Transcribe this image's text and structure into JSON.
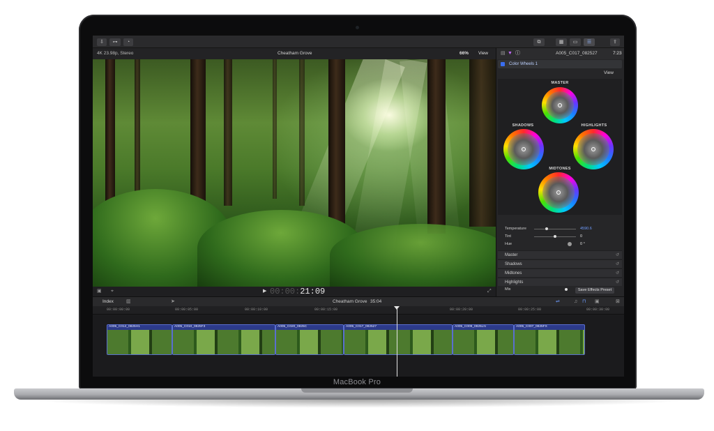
{
  "device": {
    "brand": "MacBook Pro"
  },
  "viewer": {
    "format": "4K 23.98p, Stereo",
    "title": "Cheatham Grove",
    "zoom": "66%",
    "view_label": "View",
    "timecode_dim": "00:00:",
    "timecode": "21:09"
  },
  "inspector": {
    "clip_name": "A005_C017_082527",
    "time": "7:23",
    "effect_name": "Color Wheels 1",
    "view_label": "View",
    "wheels": {
      "master": "MASTER",
      "shadows": "SHADOWS",
      "highlights": "HIGHLIGHTS",
      "midtones": "MIDTONES"
    },
    "params": [
      {
        "label": "Temperature",
        "value": "4590.6"
      },
      {
        "label": "Tint",
        "value": "0"
      },
      {
        "label": "Hue",
        "value": "0 °"
      }
    ],
    "sections": [
      "Master",
      "Shadows",
      "Midtones",
      "Highlights"
    ],
    "mix": {
      "label": "Mix",
      "value": "1.0"
    },
    "save_preset": "Save Effects Preset"
  },
  "timeline": {
    "index_label": "Index",
    "project": "Cheatham Grove",
    "duration": "35:04",
    "ruler": [
      "00:00:00:00",
      "00:00:05:00",
      "00:00:10:00",
      "00:00:15:00",
      "00:00:20:00",
      "00:00:25:00",
      "00:00:30:00"
    ],
    "clips": [
      {
        "name": "A005_C012_0825H1"
      },
      {
        "name": "A005_C010_0825F3"
      },
      {
        "name": "A005_C020_0825C"
      },
      {
        "name": "A005_C017_082527"
      },
      {
        "name": "A005_C009_0825LN"
      },
      {
        "name": "A005_C007_0825FX"
      }
    ]
  },
  "icons": [
    "import-icon",
    "keyword-icon",
    "background-tasks-icon",
    "library-icon",
    "browser-icon",
    "timeline-icon",
    "inspector-icon",
    "share-icon",
    "video-inspector-icon",
    "color-inspector-icon",
    "info-icon",
    "playhead-icon",
    "play-icon",
    "fullscreen-icon",
    "snapping-icon",
    "audio-icon"
  ]
}
